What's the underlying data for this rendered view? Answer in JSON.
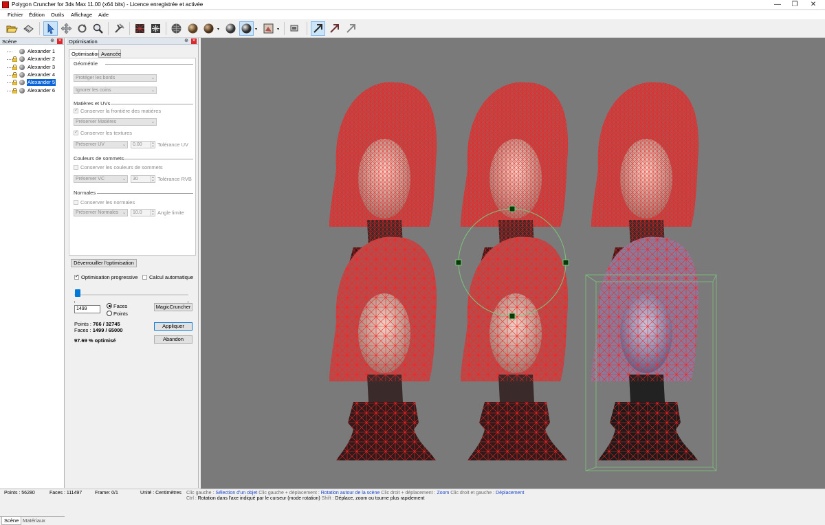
{
  "window": {
    "title": "Polygon Cruncher for 3ds Max 11.00 (x64 bits) - Licence enregistrée et activée",
    "controls": {
      "minimize": "—",
      "maximize": "❐",
      "close": "✕"
    }
  },
  "menu": [
    "Fichier",
    "Édition",
    "Outils",
    "Affichage",
    "Aide"
  ],
  "toolbar": {
    "icons": [
      "open-icon",
      "save-icon",
      "select-arrow-icon",
      "move-icon",
      "rotate-icon",
      "zoom-icon",
      "pan-icon",
      "wireframe-icon",
      "fit-icon",
      "shade-sphere-icon",
      "smooth-sphere-icon",
      "flat-sphere-icon",
      "shade-sphere-2-icon",
      "shaded-wire-sphere-icon",
      "texture-icon",
      "camera-icon",
      "arrow-up-right-icon",
      "arrow-up-right-dark-icon",
      "arrow-up-right-gray-icon"
    ],
    "colors": {
      "active_bg": "#cce4f7"
    }
  },
  "scene_panel": {
    "title": "Scène",
    "items": [
      {
        "label": "Alexander 1",
        "locked": false,
        "selected": false
      },
      {
        "label": "Alexander 2",
        "locked": true,
        "selected": false
      },
      {
        "label": "Alexander 3",
        "locked": true,
        "selected": false
      },
      {
        "label": "Alexander 4",
        "locked": true,
        "selected": false
      },
      {
        "label": "Alexander 5",
        "locked": true,
        "selected": true
      },
      {
        "label": "Alexander 6",
        "locked": true,
        "selected": false
      }
    ],
    "tabs": [
      "Scène",
      "Matériaux"
    ]
  },
  "optimization_panel": {
    "title": "Optimisation",
    "tabs": [
      "Optimisation",
      "Avancée"
    ],
    "geometry": {
      "header": "Géométrie",
      "protect_borders": "Protéger les bords",
      "ignore_corners": "Ignorer les coins"
    },
    "materials": {
      "header": "Matières et UVs",
      "keep_material_border": "Conserver la frontière des matières",
      "preserve_materials": "Préserver Matières",
      "keep_textures": "Conserver les textures",
      "preserve_uv": "Préserver UV",
      "uv_tolerance_value": "0.00",
      "uv_tolerance_label": "Tolérance UV"
    },
    "vertex_colors": {
      "header": "Couleurs de sommets",
      "keep_vertex_colors": "Conserver les couleurs de sommets",
      "preserve_vc": "Préserver VC",
      "rgb_tolerance_value": "30",
      "rgb_tolerance_label": "Tolérance RVB"
    },
    "normals": {
      "header": "Normales",
      "keep_normals": "Conserver les normales",
      "preserve_normals": "Préserver Normales",
      "angle_value": "10.0",
      "angle_label": "Angle limite"
    },
    "unlock_button": "Déverrouiller l'optimisation",
    "progressive_label": "Optimisation progressive",
    "progressive_checked": true,
    "auto_calc_label": "Calcul automatique",
    "auto_calc_checked": false,
    "slider_value": 0.03,
    "count_value": "1499",
    "radio_faces": "Faces",
    "radio_points": "Points",
    "selected_radio": "Faces",
    "magic_button": "MagicCruncher",
    "apply_button": "Appliquer",
    "abort_button": "Abandon",
    "stats": {
      "points_label": "Points :",
      "points_value": "766 / 32745",
      "faces_label": "Faces :",
      "faces_value": "1499 / 65000",
      "optimized": "97.69 % optimisé"
    }
  },
  "viewport": {
    "background": "#7a7a7a",
    "wire_color": "#ff1a1a",
    "selection_color": "#7cc47c"
  },
  "status": {
    "points": "Points : 56280",
    "faces": "Faces : 111497",
    "frame": "Frame: 0/1",
    "unit": "Unité : Centimètres",
    "hint1": [
      {
        "t": "Clic gauche : ",
        "c": "gray"
      },
      {
        "t": "Sélection d'un objet",
        "c": "blue"
      },
      {
        "t": "  Clic gauche + déplacement : ",
        "c": "gray"
      },
      {
        "t": "Rotation autour de la scène",
        "c": "blue"
      },
      {
        "t": "  Clic droit + déplacement : ",
        "c": "gray"
      },
      {
        "t": "Zoom",
        "c": "blue"
      },
      {
        "t": "  Clic droit et gauche : ",
        "c": "gray"
      },
      {
        "t": "Déplacement",
        "c": "blue"
      }
    ],
    "hint2": [
      {
        "t": "Ctrl : ",
        "c": "gray"
      },
      {
        "t": "Rotation dans l'axe indiqué par le curseur (mode rotation)",
        "c": ""
      },
      {
        "t": "  Shift : ",
        "c": "gray"
      },
      {
        "t": "Déplace, zoom ou tourne plus rapidement",
        "c": ""
      }
    ]
  }
}
